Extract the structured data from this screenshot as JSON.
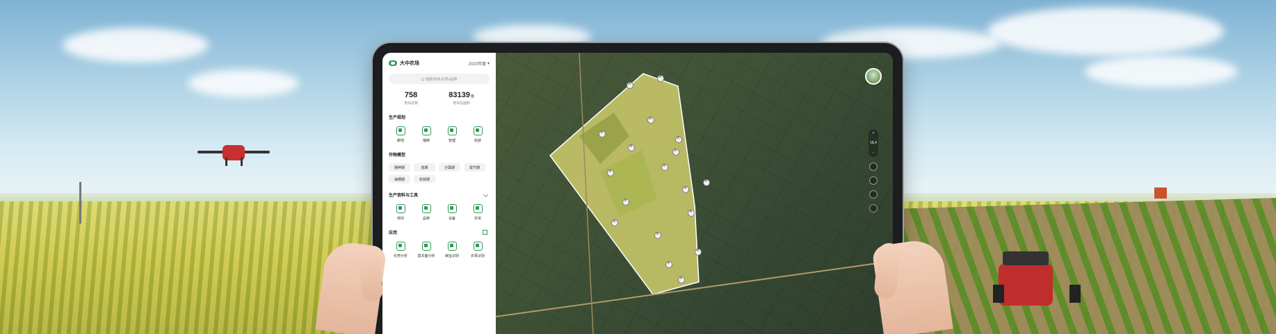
{
  "app": {
    "farm_name": "大中农场",
    "year_selector": "2020年度",
    "search_placeholder": "Q 搜索地块名称/品种"
  },
  "stats": [
    {
      "value": "758",
      "unit": "",
      "label": "地块总数"
    },
    {
      "value": "83139",
      "unit": "亩",
      "label": "地块总面积"
    }
  ],
  "sections": {
    "production_planning": {
      "title": "生产规划",
      "items": [
        "耕地",
        "播种",
        "管理",
        "收获"
      ]
    },
    "crop_model": {
      "title": "作物模型",
      "chips": [
        "播种期",
        "苗期",
        "分蘖期",
        "拔节期",
        "抽穗期",
        "收获期"
      ]
    },
    "resources": {
      "title": "生产资料与工具",
      "items": [
        "地块",
        "品种",
        "设备",
        "农资"
      ]
    },
    "apps": {
      "title": "应用",
      "items": [
        "长势分析",
        "基本面分析",
        "病虫识别",
        "农事识别"
      ]
    }
  },
  "map": {
    "zoom_level": "18.4",
    "markers_count_note": ""
  },
  "colors": {
    "accent": "#2e9a55",
    "plot_fill": "#c9c86a",
    "panel_bg": "#ffffff"
  },
  "icons": {
    "brand": "farm-logo-icon",
    "search": "search-icon",
    "chevron": "chevron-down-icon"
  }
}
